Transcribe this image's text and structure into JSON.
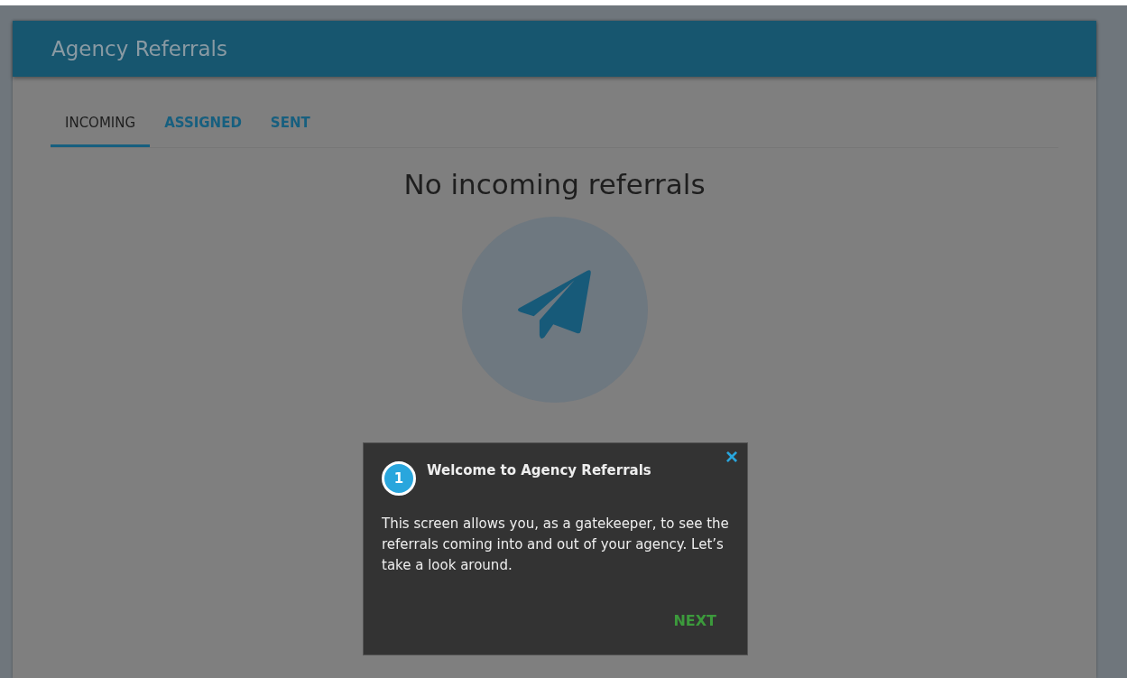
{
  "header": {
    "title": "Agency Referrals"
  },
  "tabs": [
    {
      "label": "INCOMING",
      "selected": true
    },
    {
      "label": "ASSIGNED",
      "selected": false
    },
    {
      "label": "SENT",
      "selected": false
    }
  ],
  "empty_state": {
    "message": "No incoming referrals"
  },
  "tour": {
    "step": "1",
    "title": "Welcome to Agency Referrals",
    "body": "This screen allows you, as a gatekeeper, to see the referrals coming into and out of your agency. Let’s take a look around.",
    "close": "×",
    "next": "NEXT"
  }
}
